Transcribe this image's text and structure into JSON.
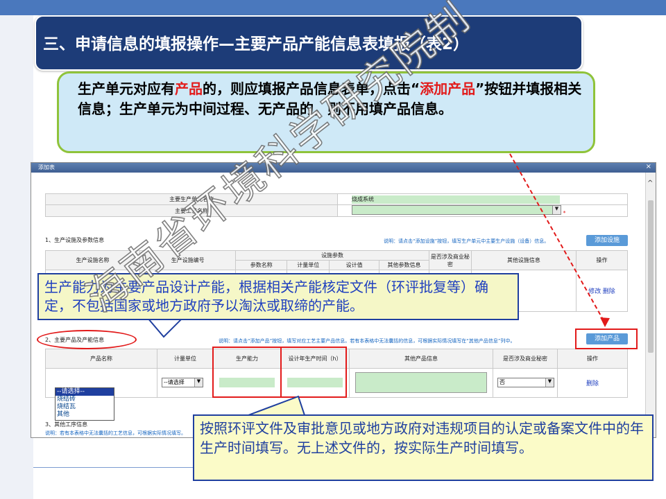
{
  "slide": {
    "title": "三、申请信息的填报操作—主要产品产能信息表填报（表2）",
    "note_top": {
      "parts": [
        {
          "text": "生产单元对应有",
          "red": false
        },
        {
          "text": "产品",
          "red": true
        },
        {
          "text": "的，则应填报产品信息表单，点击“",
          "red": false
        },
        {
          "text": "添加产品",
          "red": true
        },
        {
          "text": "”按钮并填报相关信息；生产单元为中间过程、无产品的，则不用填产品信息。",
          "red": false
        }
      ]
    },
    "callout_capacity": "生产能力为主要产品设计产能，根据相关产能核定文件（环评批复等）确定，不包括国家或地方政府予以淘汰或取缔的产能。",
    "callout_hours": "按照环评文件及审批意见或地方政府对违规项目的认定或备案文件中的年生产时间填写。无上述文件的，按实际生产时间填写。",
    "watermark": "海南省环境科学研究院制"
  },
  "dialog": {
    "title": "添加表",
    "close": "×",
    "unit_label": "主要生产单元名称",
    "unit_value": "烧成系统",
    "process_label": "主要工艺名称",
    "section1_title": "1、生产设施及参数信息",
    "section1_note": "说明：请点击“添加设施”按钮，填写生产单元中主要生产设施（设备）信息。",
    "add_facility_btn": "添加设施",
    "facility_headers": [
      "生产设施名称",
      "生产设施编号",
      "参数名称",
      "计量单位",
      "设计值",
      "其他参数信息",
      "是否涉及商业秘密",
      "其他设施信息",
      "操作"
    ],
    "facility_param_group": "设施参数",
    "facility_ops": {
      "edit": "修改",
      "delete": "删除"
    },
    "section2_title": "2、主要产品及产能信息",
    "section2_note": "说明：请点击“添加产品”按钮，填写对应工艺主要产品信息。若有本表格中无法囊括的信息，可根据实际情况填写在“其他产品信息”列中。",
    "add_product_btn": "添加产品",
    "product_headers": [
      "产品名称",
      "计量单位",
      "生产能力",
      "设计年生产时间（h）",
      "其他产品信息",
      "是否涉及商业秘密",
      "操作"
    ],
    "product_name_options": [
      "--请选择--",
      "烧结砖",
      "烧结瓦",
      "其他"
    ],
    "unit_select": "--请选择",
    "secret_select": "否",
    "delete_link": "删除",
    "section3_title": "3、其他工序信息",
    "section3_note": "说明：若有本表格中无法囊括的工艺信息，可根据实际情况填写。"
  }
}
